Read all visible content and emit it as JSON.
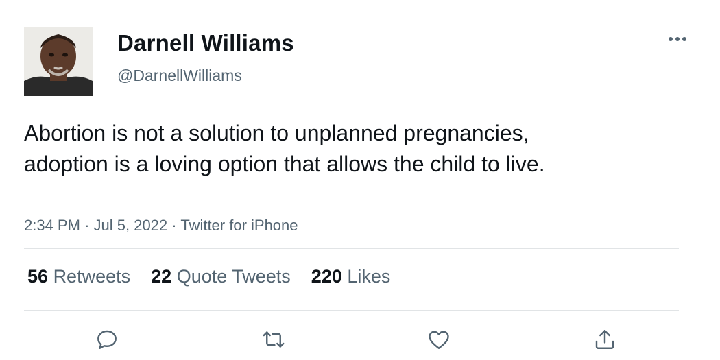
{
  "author": {
    "display_name": "Darnell Williams",
    "handle": "@DarnellWilliams"
  },
  "tweet": {
    "text": "Abortion is not a solution to unplanned pregnancies, adoption is a loving option that allows the child to live.",
    "time": "2:34 PM",
    "date": "Jul 5, 2022",
    "source": "Twitter for iPhone",
    "separator": "·"
  },
  "stats": {
    "retweets": {
      "count": "56",
      "label": "Retweets"
    },
    "quotes": {
      "count": "22",
      "label": "Quote Tweets"
    },
    "likes": {
      "count": "220",
      "label": "Likes"
    }
  },
  "icons": {
    "more": "more-horizontal-icon",
    "reply": "reply-icon",
    "retweet": "retweet-icon",
    "like": "heart-icon",
    "share": "share-icon"
  },
  "colors": {
    "text_primary": "#0f1419",
    "text_secondary": "#536471",
    "divider": "#e1e4e6"
  }
}
